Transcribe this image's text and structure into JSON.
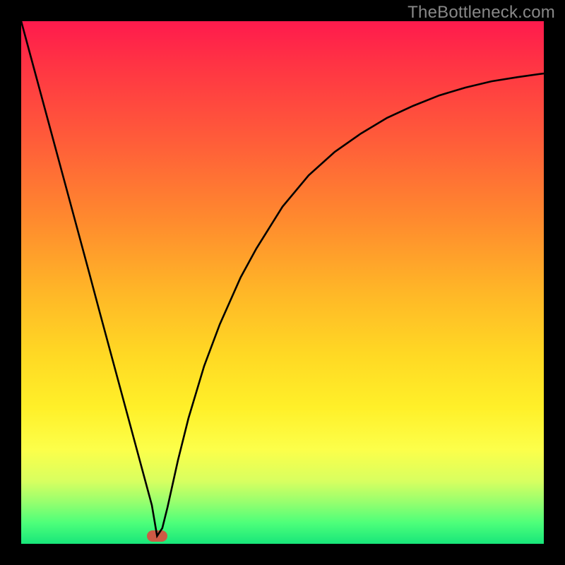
{
  "watermark": "TheBottleneck.com",
  "colors": {
    "frame": "#000000",
    "watermark": "#888888",
    "curve": "#000000",
    "marker": "#cc5a45",
    "gradient_top": "#ff1a4d",
    "gradient_bottom": "#18e67a"
  },
  "chart_data": {
    "type": "line",
    "title": "",
    "xlabel": "",
    "ylabel": "",
    "xlim": [
      0,
      100
    ],
    "ylim": [
      0,
      100
    ],
    "grid": false,
    "legend": false,
    "annotations": [],
    "marker": {
      "x": 26,
      "y": 1.5,
      "shape": "pill",
      "width_x_units": 4
    },
    "series": [
      {
        "name": "curve",
        "x": [
          0,
          3,
          5,
          8,
          10,
          13,
          15,
          18,
          20,
          23,
          25,
          26,
          27,
          28,
          30,
          32,
          35,
          38,
          42,
          45,
          50,
          55,
          60,
          65,
          70,
          75,
          80,
          85,
          90,
          95,
          100
        ],
        "values": [
          100,
          88.9,
          81.5,
          70.4,
          63.0,
          51.9,
          44.4,
          33.3,
          25.9,
          14.8,
          7.4,
          1.5,
          3.0,
          7.0,
          16.0,
          24.0,
          34.0,
          42.0,
          51.0,
          56.5,
          64.5,
          70.5,
          75.0,
          78.5,
          81.5,
          83.8,
          85.8,
          87.3,
          88.5,
          89.3,
          90.0
        ]
      }
    ]
  }
}
